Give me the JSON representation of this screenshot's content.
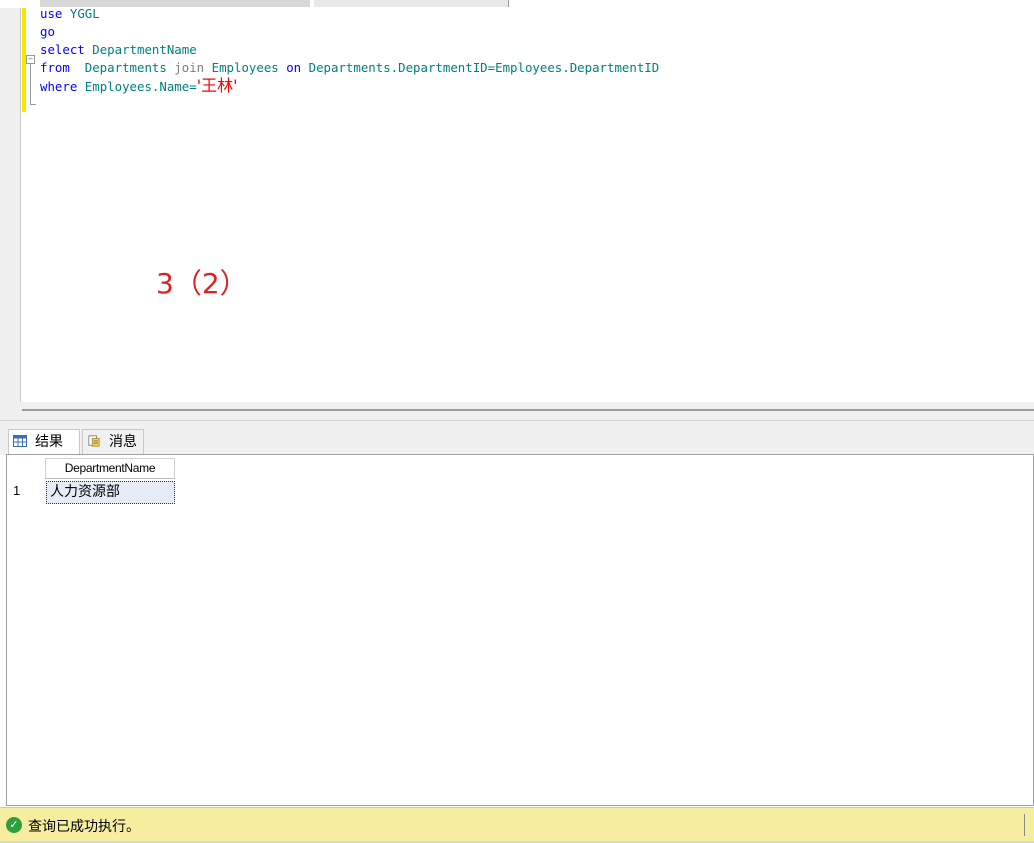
{
  "editor": {
    "code": {
      "line1": {
        "kw": "use",
        "id": "YGGL"
      },
      "line2": {
        "kw": "go"
      },
      "line3": {
        "kw": "select",
        "id": "DepartmentName"
      },
      "line4": {
        "kw": "from",
        "id1": "Departments",
        "kw2": "join",
        "id2": "Employees",
        "kw3": "on",
        "id3": "Departments.DepartmentID=Employees.DepartmentID"
      },
      "line5": {
        "kw": "where",
        "id": "Employees.Name=",
        "str": "'王林'"
      }
    },
    "annotation": "3（2）"
  },
  "results": {
    "tabs": [
      {
        "label": "结果",
        "icon": "grid-icon"
      },
      {
        "label": "消息",
        "icon": "message-icon"
      }
    ],
    "columns": [
      "DepartmentName"
    ],
    "rows": [
      {
        "num": "1",
        "cells": [
          "人力资源部"
        ]
      }
    ]
  },
  "status": {
    "icon": "check-icon",
    "message": "查询已成功执行。",
    "color": "#f7ed9e"
  }
}
